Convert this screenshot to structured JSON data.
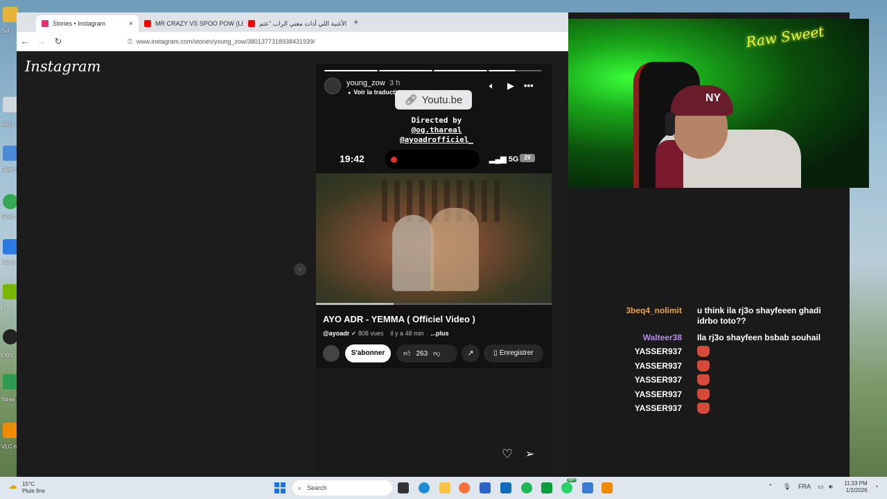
{
  "browser": {
    "tabs": [
      {
        "title": "Stories • Instagram",
        "active": true,
        "favicon_color": "#e1306c"
      },
      {
        "title": "MR CRAZY VS SPOO POW (LFEN",
        "active": false,
        "favicon_color": "#ff0000"
      },
      {
        "title": "الأغنية اللي أذات مغني الراب \"عثم",
        "active": false,
        "favicon_color": "#ff0000"
      }
    ],
    "close_label": "×",
    "new_tab_label": "+",
    "url": "www.instagram.com/stories/young_zow/3801377318938431939/"
  },
  "instagram": {
    "logo": "Instagram",
    "prev_arrow": "‹",
    "story": {
      "username": "young_zow",
      "time": "3 h",
      "translate": "Voir la traduction",
      "link_sticker": "Youtu.be",
      "directed_lines": [
        "Directed by",
        "@og.thareal",
        "@ayoadrofficiel_"
      ],
      "phone_status": {
        "clock": "19:42",
        "network": "5G",
        "battery": "29"
      },
      "video": {
        "title": "AYO ADR - YEMMA ( Officiel Video )",
        "channel": "@ayoadr",
        "views": "808 vues",
        "age": "il y a 48 min",
        "more": "...plus",
        "subscribe": "S'abonner",
        "likes": "263",
        "save": "Enregistrer",
        "progress": 0.33
      },
      "story_progress": [
        1,
        1,
        1,
        0.5
      ]
    }
  },
  "chat": [
    {
      "user": "3beq4_nolimit",
      "color": "#e8a34a",
      "text": "u think ila rj3o shayfeeen ghadi idrbo toto??"
    },
    {
      "user": "Walteer38",
      "color": "#b48ee8",
      "text": "Ila rj3o shayfeen bsbab souhail"
    },
    {
      "user": "YASSER937",
      "color": "#ffffff",
      "emote": "devil-emote"
    },
    {
      "user": "YASSER937",
      "color": "#ffffff",
      "emote": "devil-emote"
    },
    {
      "user": "YASSER937",
      "color": "#ffffff",
      "emote": "devil-emote"
    },
    {
      "user": "YASSER937",
      "color": "#ffffff",
      "emote": "devil-emote"
    },
    {
      "user": "YASSER937",
      "color": "#ffffff",
      "emote": "devil-emote"
    }
  ],
  "webcam": {
    "sign": "Raw Sweet",
    "cap_logo": "NY"
  },
  "taskbar": {
    "weather_temp": "15°C",
    "weather_desc": "Pluie fine",
    "search_placeholder": "Search",
    "lang": "FRA",
    "time": "11:33 PM",
    "date": "1/2/2026",
    "badge": "99+"
  },
  "desktop_labels": [
    "Set",
    "Recy",
    "Dow Sh",
    "Goog",
    "Micro",
    "N",
    "OBS",
    "Strea De",
    "VLC m"
  ]
}
